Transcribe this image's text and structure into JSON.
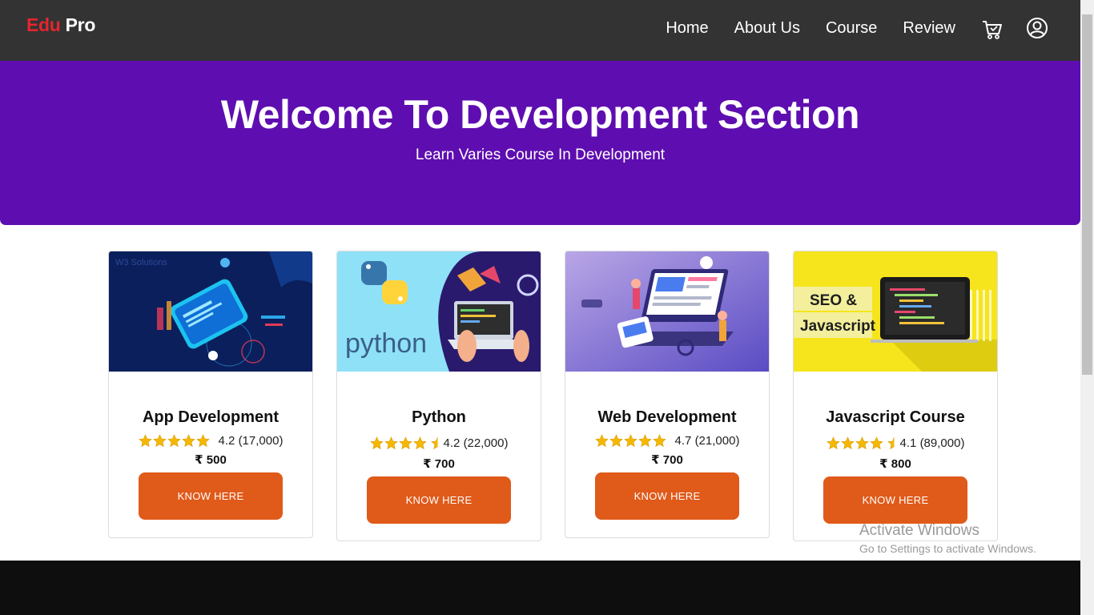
{
  "brand": {
    "part1": "Edu",
    "part2": "Pro"
  },
  "nav": {
    "links": [
      "Home",
      "About Us",
      "Course",
      "Review"
    ],
    "icons": [
      "cart-icon",
      "user-icon"
    ]
  },
  "hero": {
    "title": "Welcome To Development Section",
    "subtitle": "Learn Varies Course In Development"
  },
  "courses": [
    {
      "title": "App Development",
      "rating": 4.2,
      "rating_text": "4.2 (17,000)",
      "price": "₹ 500",
      "button": "KNOW HERE",
      "stars_filled": 5,
      "half_star": false
    },
    {
      "title": "Python",
      "rating": 4.2,
      "rating_text": "4.2 (22,000)",
      "price": "₹ 700",
      "button": "KNOW HERE",
      "stars_filled": 4,
      "half_star": true
    },
    {
      "title": "Web Development",
      "rating": 4.7,
      "rating_text": "4.7 (21,000)",
      "price": "₹ 700",
      "button": "KNOW HERE",
      "stars_filled": 5,
      "half_star": false
    },
    {
      "title": "Javascript Course",
      "rating": 4.1,
      "rating_text": "4.1 (89,000)",
      "price": "₹ 800",
      "button": "KNOW HERE",
      "stars_filled": 4,
      "half_star": true
    }
  ],
  "image_text": {
    "python": "python",
    "seo_line1": "SEO &",
    "seo_line2": "Javascript",
    "w3": "W3 Solutions"
  },
  "watermark": {
    "line1": "Activate Windows",
    "line2": "Go to Settings to activate Windows."
  },
  "colors": {
    "navbar": "#333333",
    "brand_red": "#e3262f",
    "hero": "#5e0eb0",
    "button": "#e05a1a",
    "star": "#f5b800"
  }
}
